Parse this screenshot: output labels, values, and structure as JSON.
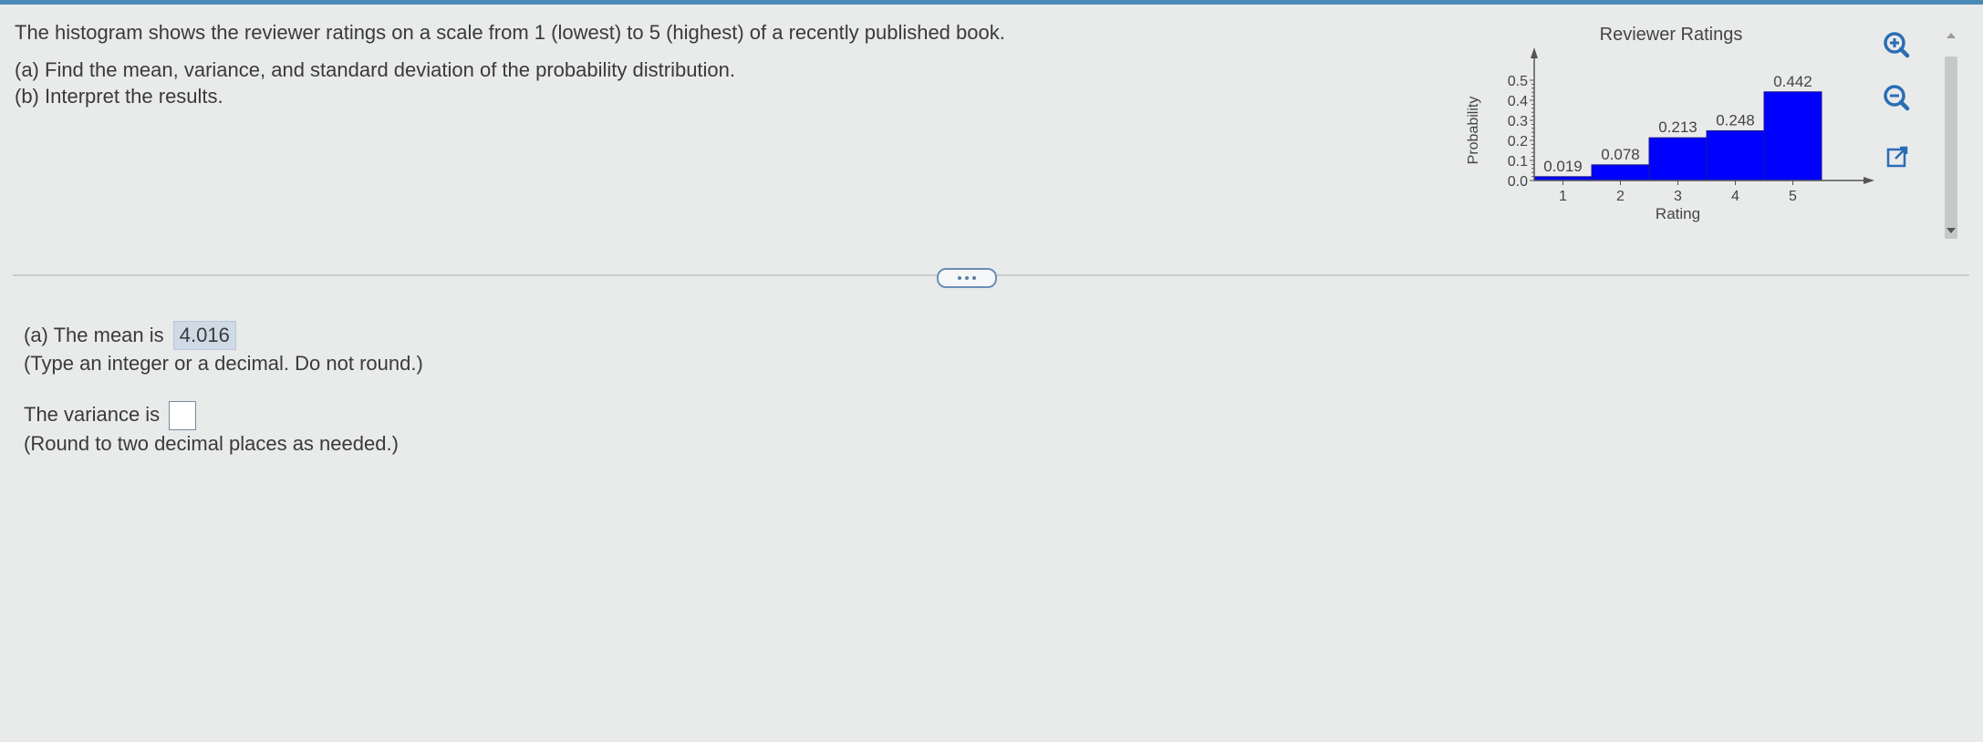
{
  "question": {
    "intro": "The histogram shows the reviewer ratings on a scale from 1 (lowest) to 5 (highest) of a recently published book.",
    "part_a": "(a) Find the mean, variance, and standard deviation of the probability distribution.",
    "part_b": "(b) Interpret the results."
  },
  "chart_data": {
    "type": "bar",
    "title": "Reviewer Ratings",
    "xlabel": "Rating",
    "ylabel": "Probability",
    "categories": [
      "1",
      "2",
      "3",
      "4",
      "5"
    ],
    "values": [
      0.019,
      0.078,
      0.213,
      0.248,
      0.442
    ],
    "data_labels": [
      "0.019",
      "0.078",
      "0.213",
      "0.248",
      "0.442"
    ],
    "y_ticks": [
      "0.0",
      "0.1",
      "0.2",
      "0.3",
      "0.4",
      "0.5"
    ],
    "ylim": [
      0,
      0.5
    ],
    "bar_color": "#0000ff",
    "grid": false
  },
  "answer": {
    "mean_prefix": "(a) The mean is",
    "mean_value": "4.016",
    "mean_hint": "(Type an integer or a decimal. Do not round.)",
    "variance_prefix": "The variance is",
    "variance_value": "",
    "variance_hint": "(Round to two decimal places as needed.)"
  },
  "tools": {
    "zoom_in": "zoom-in-icon",
    "zoom_out": "zoom-out-icon",
    "popout": "popout-icon"
  },
  "colors": {
    "accent": "#4a8ab7",
    "tool_blue": "#2a6db5",
    "highlight": "#cfdae6"
  }
}
